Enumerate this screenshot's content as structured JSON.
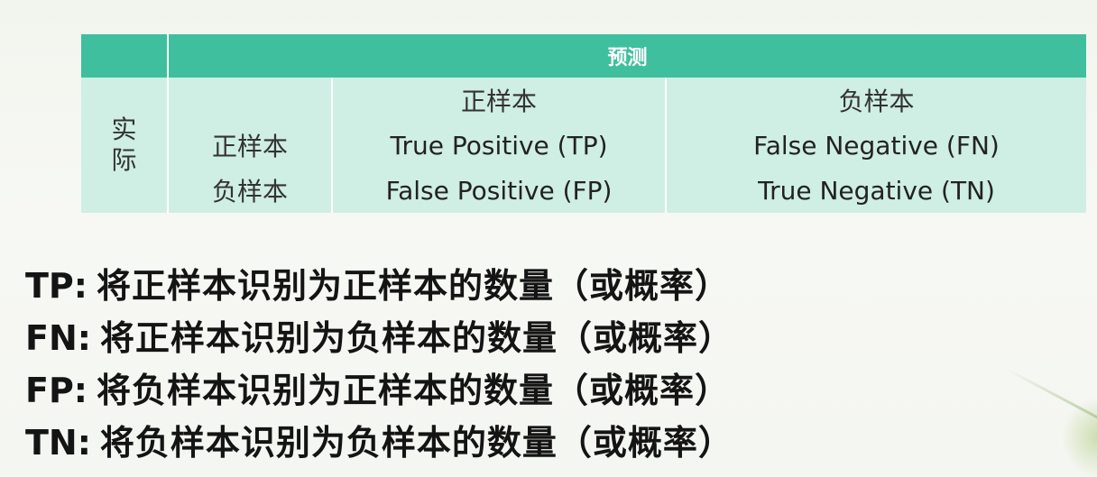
{
  "table": {
    "predict_header": "预测",
    "actual_label": "实际",
    "col_headers": [
      "正样本",
      "负样本"
    ],
    "rows": [
      {
        "label": "正样本",
        "cells": [
          "True Positive (TP)",
          "False Negative (FN)"
        ]
      },
      {
        "label": "负样本",
        "cells": [
          "False Positive (FP)",
          "True Negative (TN)"
        ]
      }
    ]
  },
  "definitions": [
    {
      "key": "TP:",
      "desc": "将正样本识别为正样本的数量（或概率）"
    },
    {
      "key": "FN:",
      "desc": "将正样本识别为负样本的数量（或概率）"
    },
    {
      "key": "FP:",
      "desc": "将负样本识别为正样本的数量（或概率）"
    },
    {
      "key": "TN:",
      "desc": "将负样本识别为负样本的数量（或概率）"
    }
  ],
  "colors": {
    "header_bg": "#3fbf9e",
    "body_bg": "#cfeee4",
    "text": "#141414"
  }
}
